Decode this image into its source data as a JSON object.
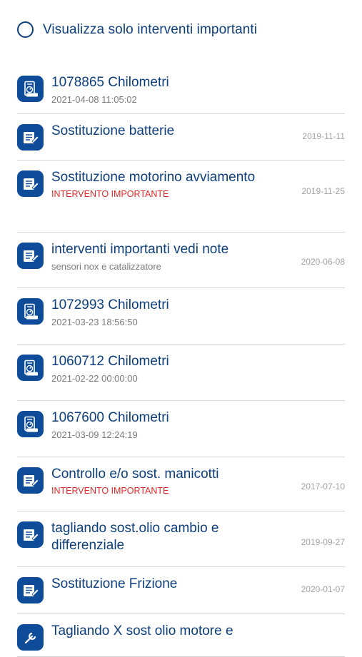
{
  "filter": {
    "label": "Visualizza solo interventi importanti",
    "checked": false
  },
  "colors": {
    "accent": "#0e3f7c",
    "icon_bg": "#0e4c9a",
    "important": "#e02a2a",
    "divider": "#d5d5d5"
  },
  "items": [
    {
      "icon": "odometer-document-icon",
      "title": "1078865 Chilometri",
      "subtitle": "2021-04-08 11:05:02",
      "important": false,
      "date": ""
    },
    {
      "icon": "repair-document-icon",
      "title": "Sostituzione batterie",
      "subtitle": "",
      "important": false,
      "date": "2019-11-11"
    },
    {
      "icon": "repair-document-icon",
      "title": "Sostituzione motorino avviamento",
      "subtitle": "INTERVENTO IMPORTANTE",
      "important": true,
      "date": "2019-11-25"
    },
    {
      "icon": "repair-document-icon",
      "title": "interventi importanti vedi note",
      "subtitle": "sensori nox e catalizzatore",
      "important": false,
      "date": "2020-06-08"
    },
    {
      "icon": "odometer-document-icon",
      "title": "1072993 Chilometri",
      "subtitle": "2021-03-23 18:56:50",
      "important": false,
      "date": ""
    },
    {
      "icon": "odometer-document-icon",
      "title": "1060712 Chilometri",
      "subtitle": "2021-02-22 00:00:00",
      "important": false,
      "date": ""
    },
    {
      "icon": "odometer-document-icon",
      "title": "1067600 Chilometri",
      "subtitle": "2021-03-09 12:24:19",
      "important": false,
      "date": ""
    },
    {
      "icon": "repair-document-icon",
      "title": "Controllo e/o sost. manicotti",
      "subtitle": "INTERVENTO IMPORTANTE",
      "important": true,
      "date": "2017-07-10"
    },
    {
      "icon": "repair-document-icon",
      "title": "tagliando  sost.olio cambio e differenziale",
      "subtitle": "",
      "important": false,
      "date": "2019-09-27"
    },
    {
      "icon": "repair-document-icon",
      "title": "Sostituzione Frizione",
      "subtitle": "",
      "important": false,
      "date": "2020-01-07"
    },
    {
      "icon": "wrench-icon",
      "title": "Tagliando X sost olio motore e",
      "subtitle": "",
      "important": false,
      "date": ""
    }
  ]
}
